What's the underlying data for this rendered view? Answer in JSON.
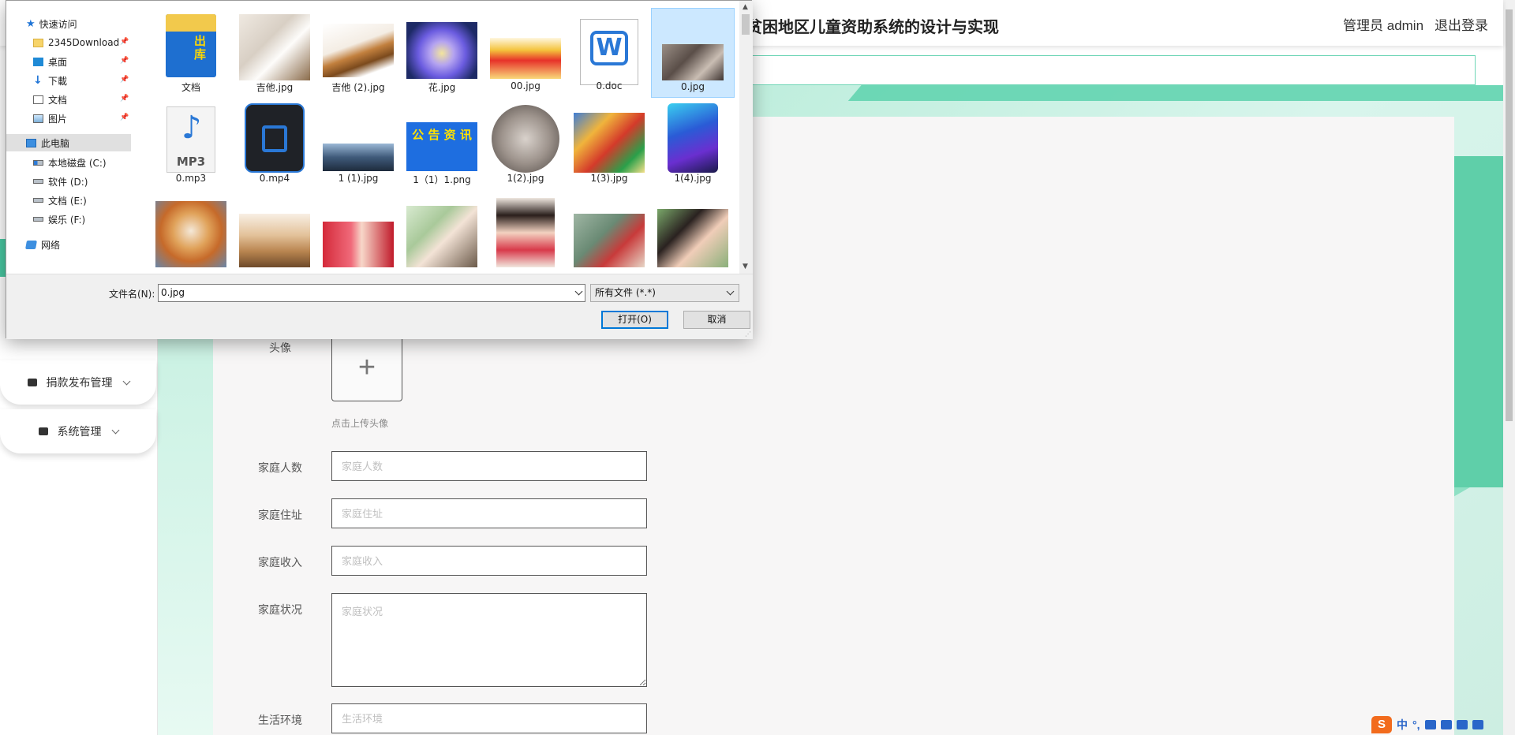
{
  "app": {
    "title": "贫困地区儿童资助系统的设计与实现",
    "role_label": "管理员",
    "username": "admin",
    "logout_label": "退出登录",
    "accent_color": "#49c9a2"
  },
  "sidebar": {
    "items": [
      {
        "label": "捐款发布管理",
        "icon": "chat-icon"
      },
      {
        "label": "系统管理",
        "icon": "computer-icon"
      }
    ]
  },
  "form": {
    "avatar_label": "头像",
    "avatar_hint": "点击上传头像",
    "fields": [
      {
        "label": "家庭人数",
        "placeholder": "家庭人数",
        "value": ""
      },
      {
        "label": "家庭住址",
        "placeholder": "家庭住址",
        "value": ""
      },
      {
        "label": "家庭收入",
        "placeholder": "家庭收入",
        "value": ""
      },
      {
        "label": "家庭状况",
        "placeholder": "家庭状况",
        "value": ""
      },
      {
        "label": "生活环境",
        "placeholder": "生活环境",
        "value": ""
      }
    ]
  },
  "ime": {
    "logo": "S",
    "mode": "中",
    "punct": "°,"
  },
  "file_dialog": {
    "nav": [
      {
        "label": "快速访问",
        "icon": "star-icon",
        "pinned": false,
        "selected": false
      },
      {
        "label": "2345Download",
        "icon": "folder-icon",
        "pinned": true,
        "selected": false
      },
      {
        "label": "桌面",
        "icon": "desktop-icon",
        "pinned": true,
        "selected": false
      },
      {
        "label": "下載",
        "icon": "download-icon",
        "pinned": true,
        "selected": false
      },
      {
        "label": "文档",
        "icon": "document-icon",
        "pinned": true,
        "selected": false
      },
      {
        "label": "图片",
        "icon": "picture-icon",
        "pinned": true,
        "selected": false
      },
      {
        "label": "此电脑",
        "icon": "computer-icon",
        "pinned": false,
        "selected": true
      },
      {
        "label": "本地磁盘 (C:)",
        "icon": "system-drive-icon",
        "pinned": false,
        "selected": false
      },
      {
        "label": "软件 (D:)",
        "icon": "drive-icon",
        "pinned": false,
        "selected": false
      },
      {
        "label": "文档 (E:)",
        "icon": "drive-icon",
        "pinned": false,
        "selected": false
      },
      {
        "label": "娱乐 (F:)",
        "icon": "drive-icon",
        "pinned": false,
        "selected": false
      },
      {
        "label": "网络",
        "icon": "network-icon",
        "pinned": false,
        "selected": false
      }
    ],
    "files": [
      {
        "name": "文档",
        "kind": "folder",
        "selected": false
      },
      {
        "name": "吉他.jpg",
        "kind": "image",
        "selected": false
      },
      {
        "name": "吉他 (2).jpg",
        "kind": "image",
        "selected": false
      },
      {
        "name": "花.jpg",
        "kind": "image",
        "selected": false
      },
      {
        "name": "00.jpg",
        "kind": "image",
        "selected": false
      },
      {
        "name": "0.doc",
        "kind": "word",
        "selected": false
      },
      {
        "name": "0.jpg",
        "kind": "image",
        "selected": true
      },
      {
        "name": "0.mp3",
        "kind": "audio",
        "selected": false
      },
      {
        "name": "0.mp4",
        "kind": "video",
        "selected": false
      },
      {
        "name": "1 (1).jpg",
        "kind": "image",
        "selected": false
      },
      {
        "name": "1（1）1.png",
        "kind": "notice",
        "selected": false
      },
      {
        "name": "1(2).jpg",
        "kind": "image",
        "selected": false
      },
      {
        "name": "1(3).jpg",
        "kind": "image",
        "selected": false
      },
      {
        "name": "1(4).jpg",
        "kind": "image",
        "selected": false
      },
      {
        "name": "",
        "kind": "image",
        "selected": false
      },
      {
        "name": "",
        "kind": "image",
        "selected": false
      },
      {
        "name": "",
        "kind": "image",
        "selected": false
      },
      {
        "name": "",
        "kind": "image",
        "selected": false
      },
      {
        "name": "",
        "kind": "image",
        "selected": false
      },
      {
        "name": "",
        "kind": "image",
        "selected": false
      },
      {
        "name": "",
        "kind": "image",
        "selected": false
      }
    ],
    "notice_text": "公 告 资 讯",
    "filename_label": "文件名(N):",
    "filename_value": "0.jpg",
    "filetype_value": "所有文件 (*.*)",
    "open_label": "打开(O)",
    "cancel_label": "取消"
  }
}
